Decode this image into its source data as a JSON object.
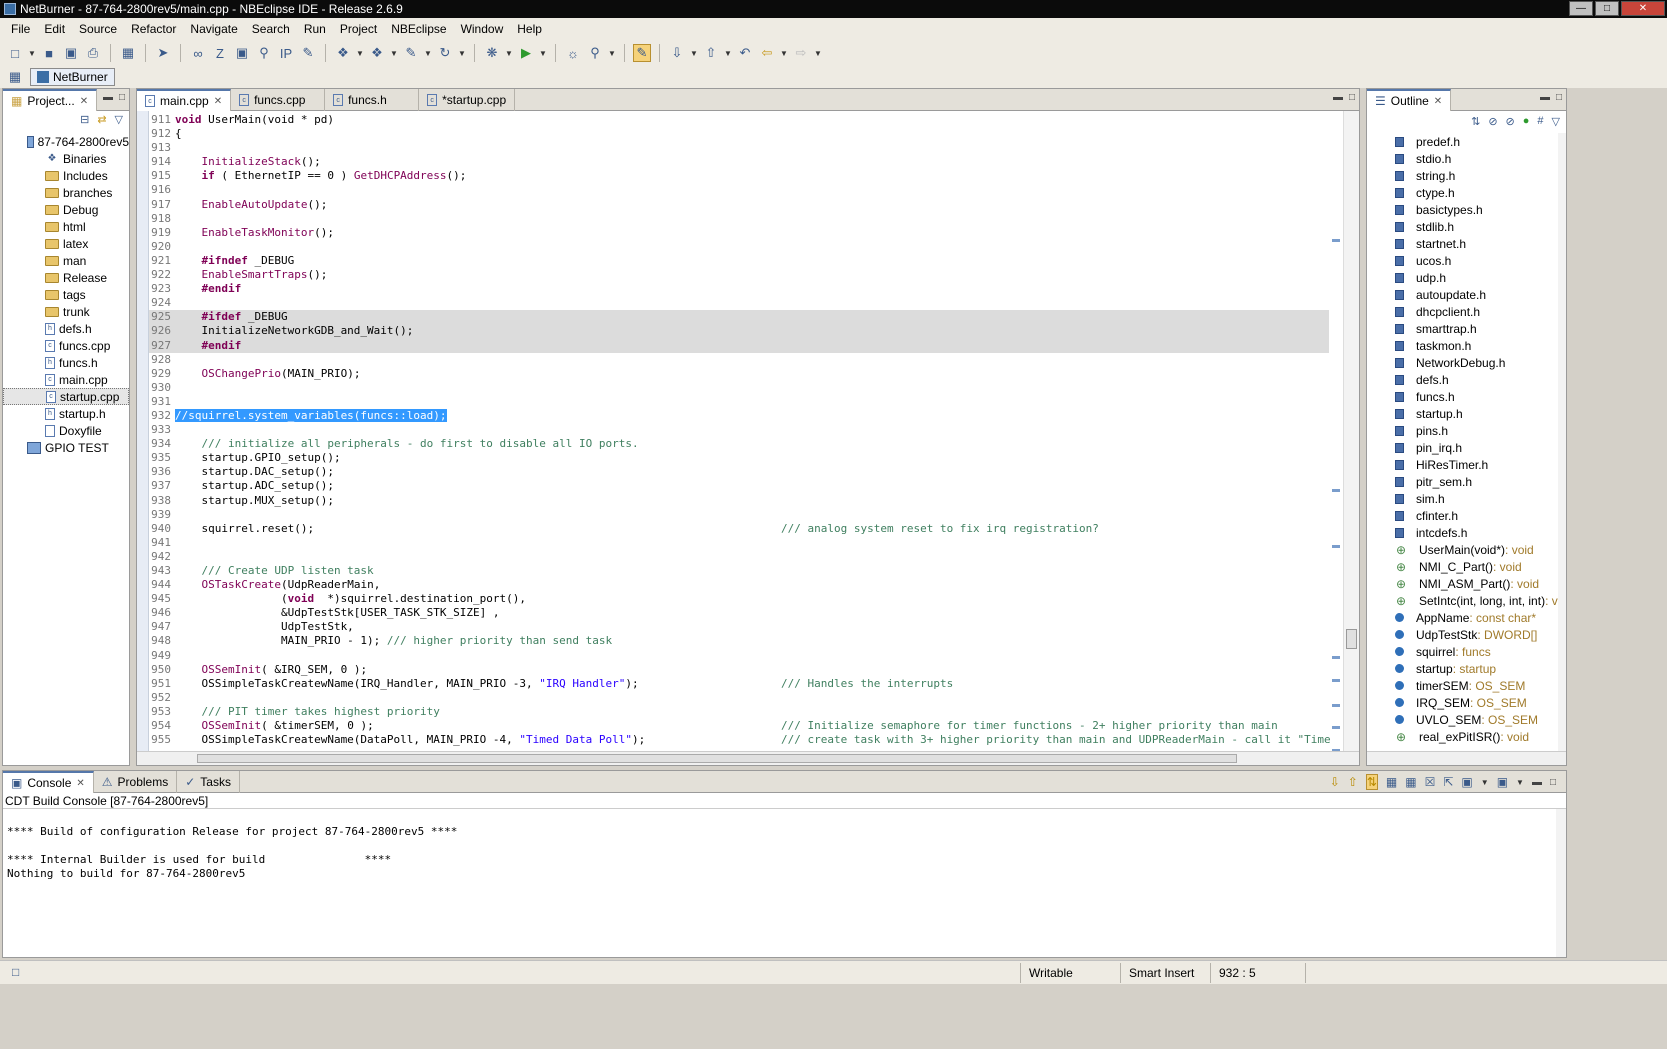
{
  "window": {
    "title": "NetBurner - 87-764-2800rev5/main.cpp - NBEclipse IDE - Release 2.6.9"
  },
  "menu": [
    "File",
    "Edit",
    "Source",
    "Refactor",
    "Navigate",
    "Search",
    "Run",
    "Project",
    "NBEclipse",
    "Window",
    "Help"
  ],
  "perspective": {
    "label": "NetBurner"
  },
  "project": {
    "tab_label": "Project...",
    "items": [
      {
        "label": "87-764-2800rev5",
        "kind": "project",
        "indent": 0
      },
      {
        "label": "Binaries",
        "kind": "binaries",
        "indent": 1
      },
      {
        "label": "Includes",
        "kind": "includes",
        "indent": 1
      },
      {
        "label": "branches",
        "kind": "folder",
        "indent": 1
      },
      {
        "label": "Debug",
        "kind": "folder",
        "indent": 1
      },
      {
        "label": "html",
        "kind": "folder",
        "indent": 1
      },
      {
        "label": "latex",
        "kind": "folder",
        "indent": 1
      },
      {
        "label": "man",
        "kind": "folder",
        "indent": 1
      },
      {
        "label": "Release",
        "kind": "folder",
        "indent": 1
      },
      {
        "label": "tags",
        "kind": "folder",
        "indent": 1
      },
      {
        "label": "trunk",
        "kind": "folder",
        "indent": 1
      },
      {
        "label": "defs.h",
        "kind": "h",
        "indent": 1
      },
      {
        "label": "funcs.cpp",
        "kind": "c",
        "indent": 1
      },
      {
        "label": "funcs.h",
        "kind": "h",
        "indent": 1
      },
      {
        "label": "main.cpp",
        "kind": "c",
        "indent": 1
      },
      {
        "label": "startup.cpp",
        "kind": "c",
        "indent": 1,
        "selected": true
      },
      {
        "label": "startup.h",
        "kind": "h",
        "indent": 1
      },
      {
        "label": "Doxyfile",
        "kind": "file",
        "indent": 1
      },
      {
        "label": "GPIO TEST",
        "kind": "project",
        "indent": 0
      }
    ]
  },
  "editor": {
    "tabs": [
      {
        "label": "main.cpp",
        "active": true
      },
      {
        "label": "funcs.cpp",
        "active": false
      },
      {
        "label": "funcs.h",
        "active": false
      },
      {
        "label": "*startup.cpp",
        "active": false
      }
    ],
    "lines": [
      {
        "n": "911",
        "code": "void UserMain(void * pd)",
        "type": "decl"
      },
      {
        "n": "912",
        "code": "{",
        "type": "plain"
      },
      {
        "n": "913",
        "code": "",
        "type": "plain"
      },
      {
        "n": "914",
        "code": "    InitializeStack();",
        "type": "call"
      },
      {
        "n": "915",
        "code": "    if ( EthernetIP == 0 ) GetDHCPAddress();",
        "type": "if"
      },
      {
        "n": "916",
        "code": "",
        "type": "plain"
      },
      {
        "n": "917",
        "code": "    EnableAutoUpdate();",
        "type": "call"
      },
      {
        "n": "918",
        "code": "",
        "type": "plain"
      },
      {
        "n": "919",
        "code": "    EnableTaskMonitor();",
        "type": "call"
      },
      {
        "n": "920",
        "code": "",
        "type": "plain"
      },
      {
        "n": "921",
        "code": "    #ifndef _DEBUG",
        "type": "pre"
      },
      {
        "n": "922",
        "code": "    EnableSmartTraps();",
        "type": "call"
      },
      {
        "n": "923",
        "code": "    #endif",
        "type": "pre"
      },
      {
        "n": "924",
        "code": "",
        "type": "plain"
      },
      {
        "n": "925",
        "code": "    #ifdef _DEBUG",
        "type": "pre",
        "dim": true
      },
      {
        "n": "926",
        "code": "    InitializeNetworkGDB_and_Wait();",
        "type": "plain",
        "dim": true
      },
      {
        "n": "927",
        "code": "    #endif",
        "type": "pre",
        "dim": true
      },
      {
        "n": "928",
        "code": "",
        "type": "plain"
      },
      {
        "n": "929",
        "code": "    OSChangePrio(MAIN_PRIO);",
        "type": "call"
      },
      {
        "n": "930",
        "code": "",
        "type": "plain"
      },
      {
        "n": "931",
        "code": "",
        "type": "plain"
      },
      {
        "n": "932",
        "code": "//squirrel.system_variables(funcs::load);",
        "type": "selected"
      },
      {
        "n": "933",
        "code": "",
        "type": "plain"
      },
      {
        "n": "934",
        "code": "    /// initialize all peripherals - do first to disable all IO ports.",
        "type": "comment"
      },
      {
        "n": "935",
        "code": "    startup.GPIO_setup();",
        "type": "plain"
      },
      {
        "n": "936",
        "code": "    startup.DAC_setup();",
        "type": "plain"
      },
      {
        "n": "937",
        "code": "    startup.ADC_setup();",
        "type": "plain"
      },
      {
        "n": "938",
        "code": "    startup.MUX_setup();",
        "type": "plain"
      },
      {
        "n": "939",
        "code": "",
        "type": "plain"
      },
      {
        "n": "940",
        "code": "    squirrel.reset();",
        "type": "plain",
        "right": "/// analog system reset to fix irq registration?"
      },
      {
        "n": "941",
        "code": "",
        "type": "plain"
      },
      {
        "n": "942",
        "code": "",
        "type": "plain"
      },
      {
        "n": "943",
        "code": "    /// Create UDP listen task",
        "type": "comment"
      },
      {
        "n": "944",
        "code": "    OSTaskCreate(UdpReaderMain,",
        "type": "call"
      },
      {
        "n": "945",
        "code": "                (void  *)squirrel.destination_port(),",
        "type": "void"
      },
      {
        "n": "946",
        "code": "                &UdpTestStk[USER_TASK_STK_SIZE] ,",
        "type": "plain"
      },
      {
        "n": "947",
        "code": "                UdpTestStk,",
        "type": "plain"
      },
      {
        "n": "948",
        "code": "                MAIN_PRIO - 1); /// higher priority than send task",
        "type": "trail"
      },
      {
        "n": "949",
        "code": "",
        "type": "plain"
      },
      {
        "n": "950",
        "code": "    OSSemInit( &IRQ_SEM, 0 );",
        "type": "call"
      },
      {
        "n": "951",
        "code": "    OSSimpleTaskCreatewName(IRQ_Handler, MAIN_PRIO -3, \"IRQ Handler\");",
        "type": "str",
        "right": "/// Handles the interrupts"
      },
      {
        "n": "952",
        "code": "",
        "type": "plain"
      },
      {
        "n": "953",
        "code": "    /// PIT timer takes highest priority",
        "type": "comment"
      },
      {
        "n": "954",
        "code": "    OSSemInit( &timerSEM, 0 );",
        "type": "call",
        "right": "/// Initialize semaphore for timer functions - 2+ higher priority than main"
      },
      {
        "n": "955",
        "code": "    OSSimpleTaskCreatewName(DataPoll, MAIN_PRIO -4, \"Timed Data Poll\");",
        "type": "str",
        "right": "/// create task with 3+ higher priority than main and UDPReaderMain - call it \"Time"
      }
    ]
  },
  "outline": {
    "tab_label": "Outline",
    "items": [
      {
        "label": "predef.h",
        "kind": "include"
      },
      {
        "label": "stdio.h",
        "kind": "include"
      },
      {
        "label": "string.h",
        "kind": "include"
      },
      {
        "label": "ctype.h",
        "kind": "include"
      },
      {
        "label": "basictypes.h",
        "kind": "include"
      },
      {
        "label": "stdlib.h",
        "kind": "include"
      },
      {
        "label": "startnet.h",
        "kind": "include"
      },
      {
        "label": "ucos.h",
        "kind": "include"
      },
      {
        "label": "udp.h",
        "kind": "include"
      },
      {
        "label": "autoupdate.h",
        "kind": "include"
      },
      {
        "label": "dhcpclient.h",
        "kind": "include"
      },
      {
        "label": "smarttrap.h",
        "kind": "include"
      },
      {
        "label": "taskmon.h",
        "kind": "include"
      },
      {
        "label": "NetworkDebug.h",
        "kind": "include"
      },
      {
        "label": "defs.h",
        "kind": "include"
      },
      {
        "label": "funcs.h",
        "kind": "include"
      },
      {
        "label": "startup.h",
        "kind": "include"
      },
      {
        "label": "pins.h",
        "kind": "include"
      },
      {
        "label": "pin_irq.h",
        "kind": "include"
      },
      {
        "label": "HiResTimer.h",
        "kind": "include"
      },
      {
        "label": "pitr_sem.h",
        "kind": "include"
      },
      {
        "label": "sim.h",
        "kind": "include"
      },
      {
        "label": "cfinter.h",
        "kind": "include"
      },
      {
        "label": "intcdefs.h",
        "kind": "include"
      },
      {
        "label": "UserMain(void*)",
        "type": " : void",
        "kind": "function"
      },
      {
        "label": "NMI_C_Part()",
        "type": " : void",
        "kind": "function"
      },
      {
        "label": "NMI_ASM_Part()",
        "type": " : void",
        "kind": "function"
      },
      {
        "label": "SetIntc(int, long, int, int)",
        "type": " : v",
        "kind": "function"
      },
      {
        "label": "AppName",
        "type": " : const char*",
        "kind": "variable"
      },
      {
        "label": "UdpTestStk",
        "type": " : DWORD[]",
        "kind": "variable"
      },
      {
        "label": "squirrel",
        "type": " : funcs",
        "kind": "variable"
      },
      {
        "label": "startup",
        "type": " : startup",
        "kind": "variable"
      },
      {
        "label": "timerSEM",
        "type": " : OS_SEM",
        "kind": "variable"
      },
      {
        "label": "IRQ_SEM",
        "type": " : OS_SEM",
        "kind": "variable"
      },
      {
        "label": "UVLO_SEM",
        "type": " : OS_SEM",
        "kind": "variable"
      },
      {
        "label": "real_exPitISR()",
        "type": " : void",
        "kind": "function"
      }
    ]
  },
  "console": {
    "tabs": [
      {
        "label": "Console",
        "active": true
      },
      {
        "label": "Problems",
        "active": false
      },
      {
        "label": "Tasks",
        "active": false
      }
    ],
    "subtitle": "CDT Build Console [87-764-2800rev5]",
    "lines": [
      "**** Build of configuration Release for project 87-764-2800rev5 ****",
      "",
      "**** Internal Builder is used for build               ****",
      "Nothing to build for 87-764-2800rev5"
    ]
  },
  "status": {
    "writable": "Writable",
    "insert_mode": "Smart Insert",
    "position": "932 : 5"
  }
}
